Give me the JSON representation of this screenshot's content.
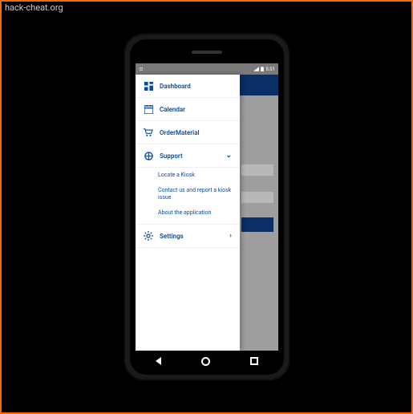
{
  "watermark": "hack-cheat.org",
  "statusbar": {
    "time": "5:51"
  },
  "nav": {
    "dashboard": "Dashboard",
    "calendar": "Calendar",
    "order": "OrderMaterial",
    "support": "Support",
    "support_sub": {
      "locate": "Locate a Kiosk",
      "contact": "Contact us and report a kiosk issue",
      "about": "About the application"
    },
    "settings": "Settings"
  }
}
